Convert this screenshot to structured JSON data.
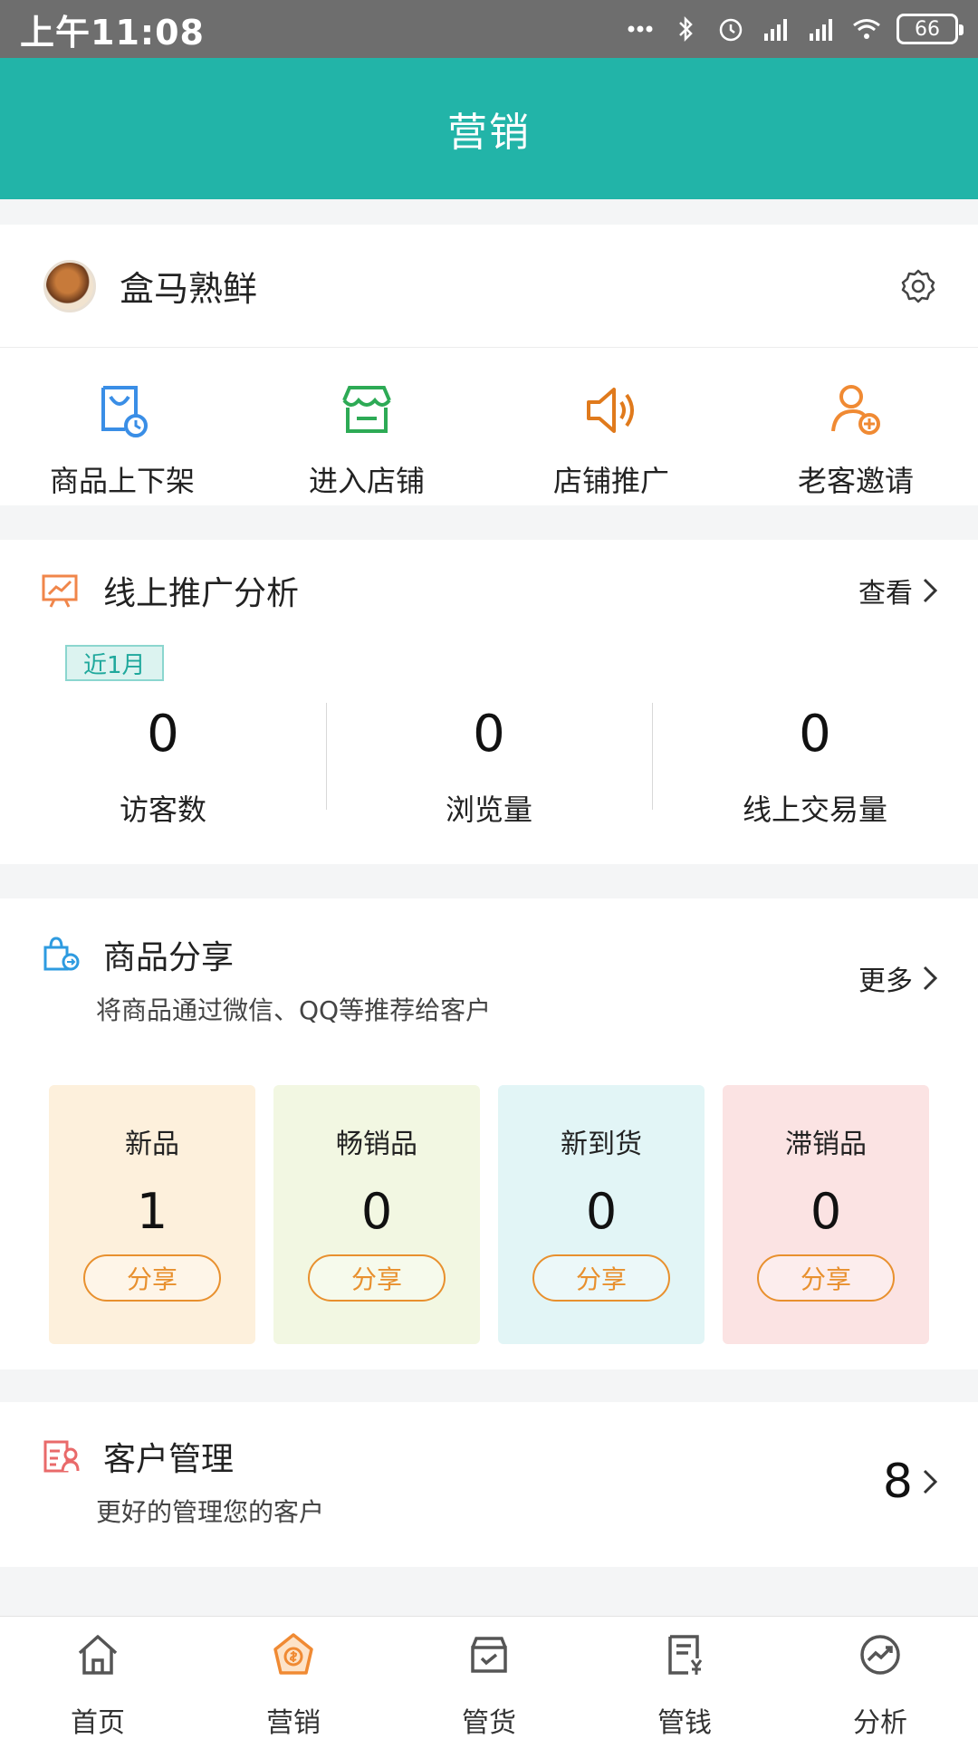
{
  "status_bar": {
    "time": "上午11:08",
    "battery": "66"
  },
  "header": {
    "title": "营销"
  },
  "store": {
    "name": "盒马熟鲜",
    "actions": [
      {
        "label": "商品上下架",
        "icon": "shelf-icon",
        "color": "#3a8ee6"
      },
      {
        "label": "进入店铺",
        "icon": "store-icon",
        "color": "#2daa55"
      },
      {
        "label": "店铺推广",
        "icon": "speaker-icon",
        "color": "#e07a1c"
      },
      {
        "label": "老客邀请",
        "icon": "invite-user-icon",
        "color": "#f08a33"
      }
    ]
  },
  "analysis": {
    "title": "线上推广分析",
    "view_label": "查看",
    "period": "近1月",
    "metrics": [
      {
        "value": "0",
        "label": "访客数"
      },
      {
        "value": "0",
        "label": "浏览量"
      },
      {
        "value": "0",
        "label": "线上交易量"
      }
    ]
  },
  "share": {
    "title": "商品分享",
    "subtitle": "将商品通过微信、QQ等推荐给客户",
    "more_label": "更多",
    "tiles": [
      {
        "name": "新品",
        "count": "1",
        "button": "分享",
        "bg": "#fdf0dc",
        "accent": "#e8902e"
      },
      {
        "name": "畅销品",
        "count": "0",
        "button": "分享",
        "bg": "#f2f7e2",
        "accent": "#e8902e"
      },
      {
        "name": "新到货",
        "count": "0",
        "button": "分享",
        "bg": "#e2f5f6",
        "accent": "#e8902e"
      },
      {
        "name": "滞销品",
        "count": "0",
        "button": "分享",
        "bg": "#fbe3e3",
        "accent": "#e8902e"
      }
    ]
  },
  "customer": {
    "title": "客户管理",
    "subtitle": "更好的管理您的客户",
    "count": "8"
  },
  "bottom_nav": [
    {
      "label": "首页",
      "icon": "home-icon"
    },
    {
      "label": "营销",
      "icon": "marketing-icon",
      "active": true
    },
    {
      "label": "管货",
      "icon": "goods-icon"
    },
    {
      "label": "管钱",
      "icon": "money-icon"
    },
    {
      "label": "分析",
      "icon": "analytics-icon"
    }
  ],
  "colors": {
    "primary": "#22b4a8",
    "accent": "#e8902e"
  }
}
